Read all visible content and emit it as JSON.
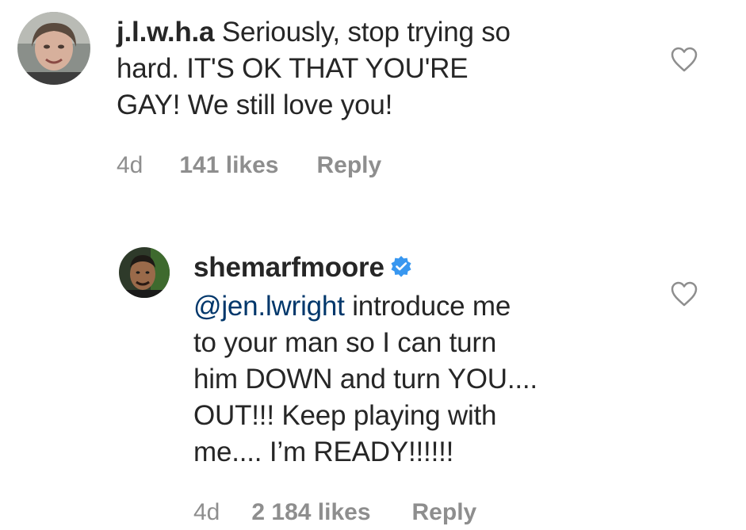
{
  "comments": [
    {
      "username": "j.l.w.h.a",
      "text_lines": [
        "Seriously, stop trying so",
        "hard. IT'S OK THAT YOU'RE",
        "GAY! We still love you!"
      ],
      "time": "4d",
      "likes": "141 likes",
      "reply_label": "Reply",
      "like_icon": "heart-outline-icon"
    },
    {
      "username": "shemarfmoore",
      "verified": true,
      "verified_icon": "verified-badge-icon",
      "mention": "@jen.lwright",
      "text_first_line_rest": " introduce me",
      "text_lines": [
        "to your man so I can turn",
        "him DOWN and turn YOU....",
        "OUT!!! Keep playing with",
        "me.... I’m READY!!!!!!"
      ],
      "time": "4d",
      "likes": "2 184 likes",
      "reply_label": "Reply",
      "like_icon": "heart-outline-icon"
    }
  ],
  "colors": {
    "text": "#262626",
    "meta": "#8e8e8e",
    "mention": "#00376b",
    "verified": "#3897f0"
  }
}
